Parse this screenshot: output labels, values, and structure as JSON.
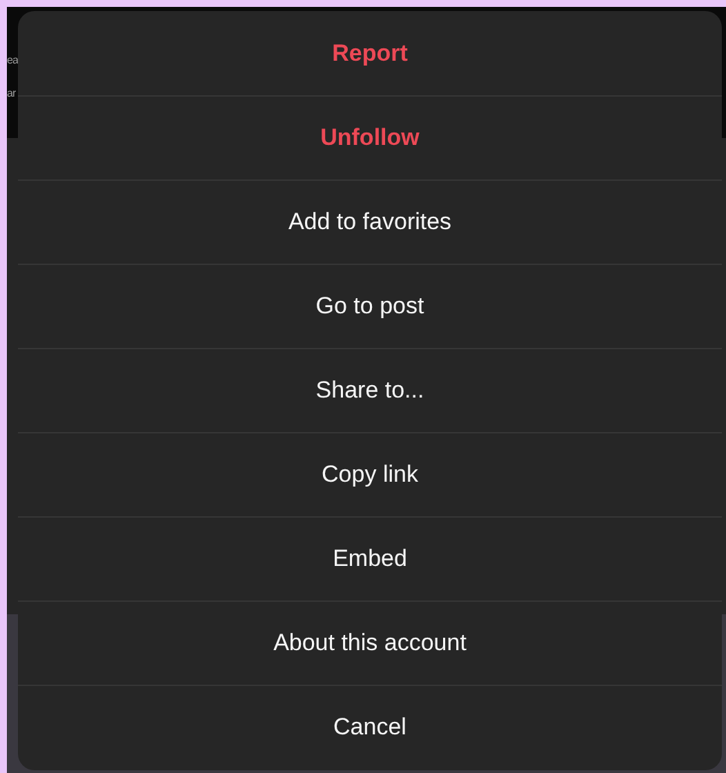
{
  "background": {
    "texts": [
      "ea",
      "ar"
    ]
  },
  "menu": {
    "items": [
      {
        "label": "Report",
        "kind": "danger"
      },
      {
        "label": "Unfollow",
        "kind": "danger"
      },
      {
        "label": "Add to favorites",
        "kind": "normal"
      },
      {
        "label": "Go to post",
        "kind": "normal"
      },
      {
        "label": "Share to...",
        "kind": "normal"
      },
      {
        "label": "Copy link",
        "kind": "normal"
      },
      {
        "label": "Embed",
        "kind": "normal"
      },
      {
        "label": "About this account",
        "kind": "normal"
      },
      {
        "label": "Cancel",
        "kind": "normal"
      }
    ]
  }
}
